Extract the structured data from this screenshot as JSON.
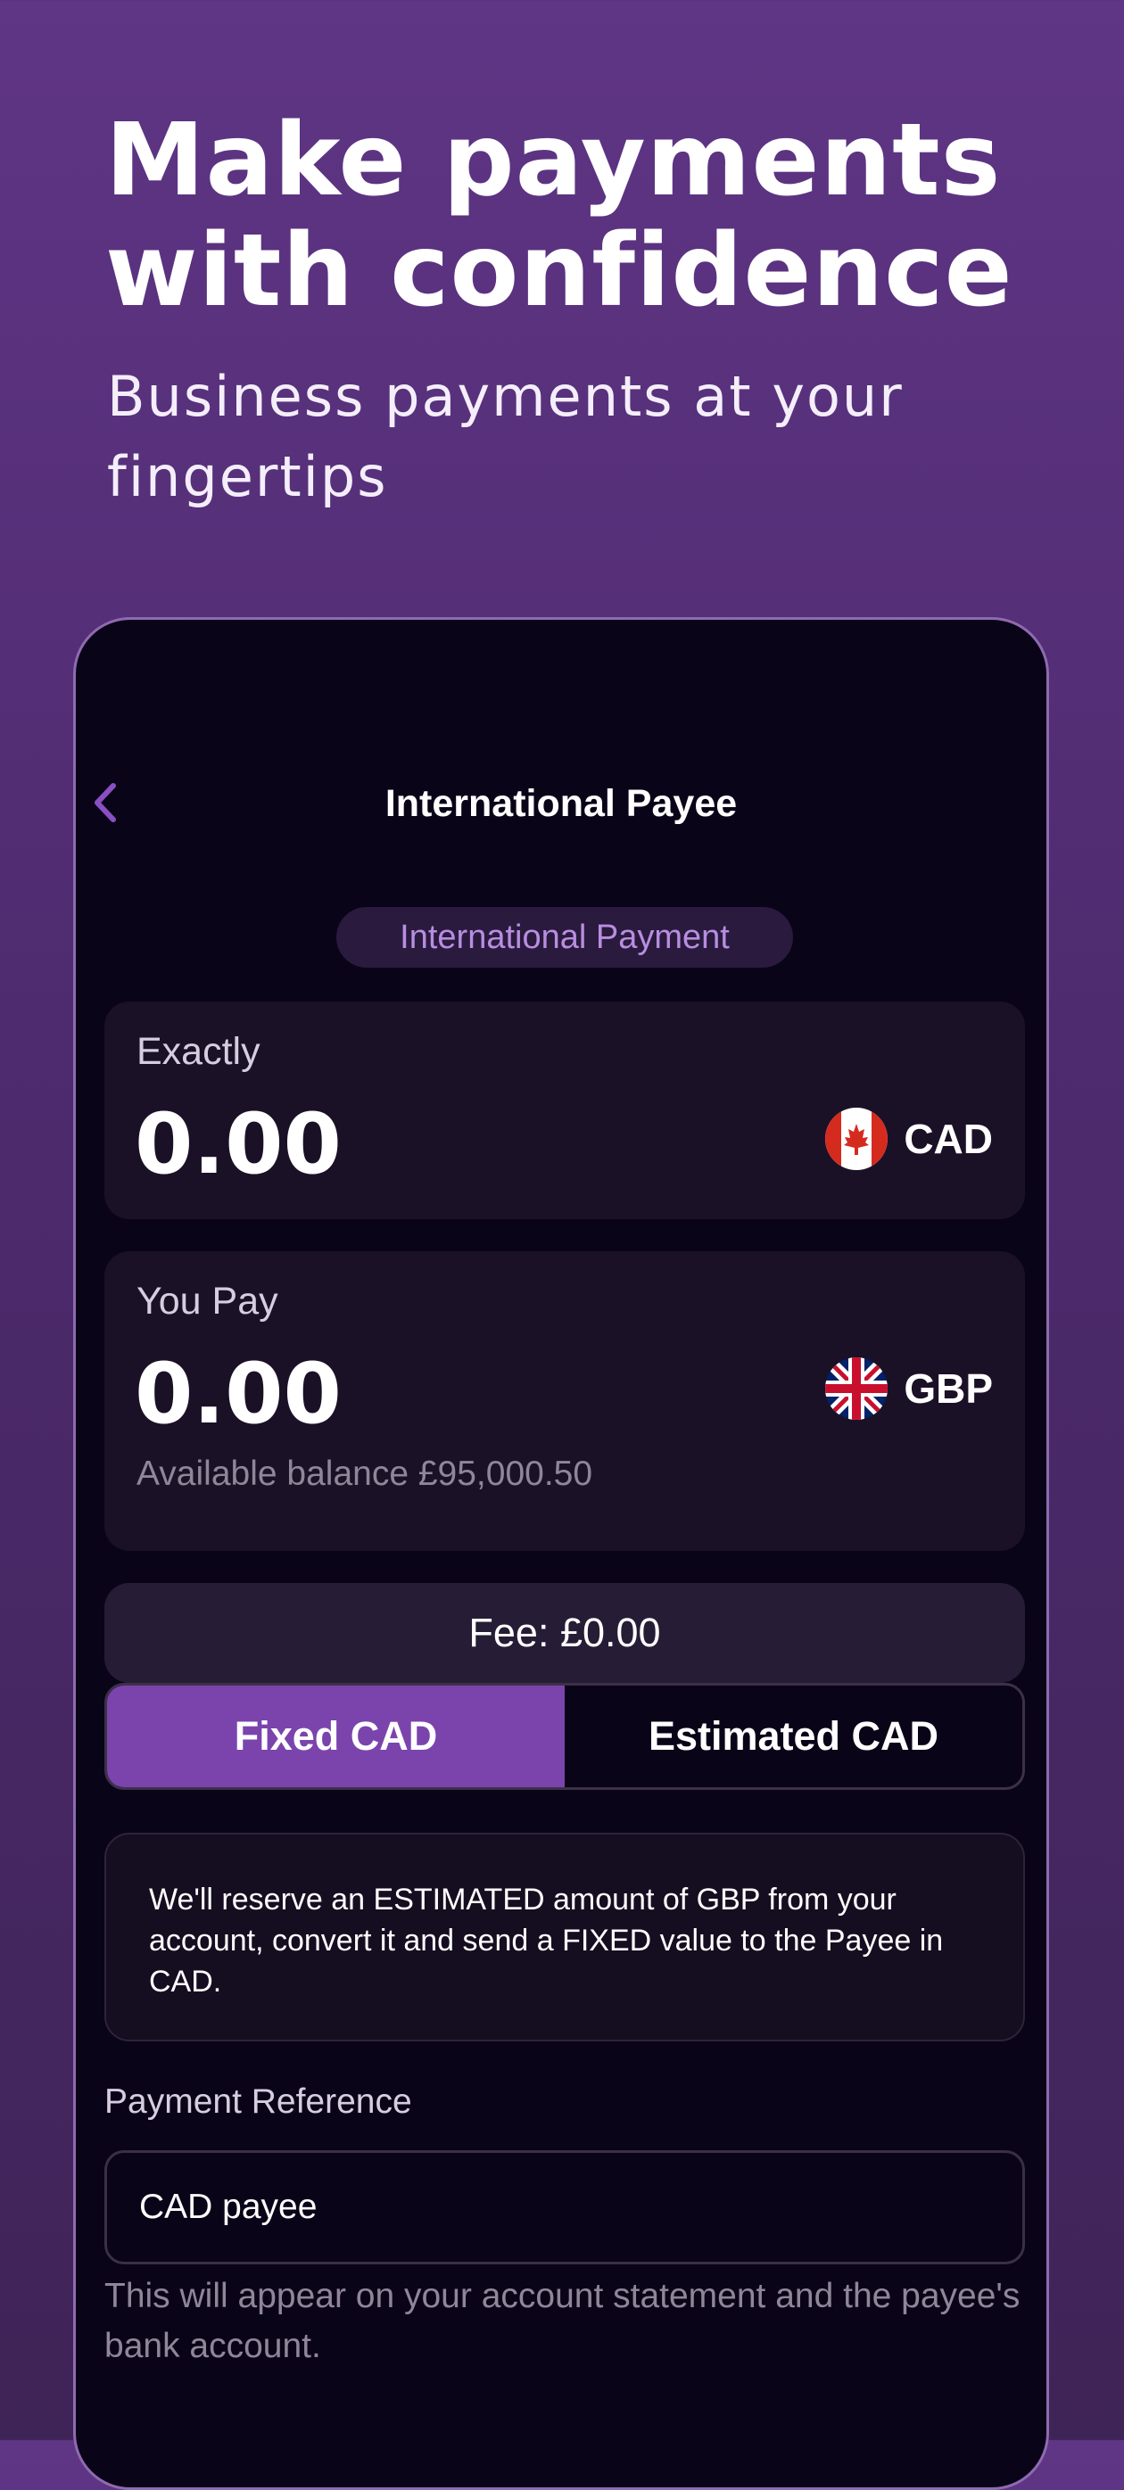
{
  "hero": {
    "title": "Make payments\nwith confidence",
    "subtitle": "Business payments at your fingertips"
  },
  "screen": {
    "title": "International Payee",
    "back_icon": "chevron-left-icon",
    "pill_label": "International Payment"
  },
  "exactly": {
    "label": "Exactly",
    "amount": "0.00",
    "currency": "CAD",
    "flag_icon": "canada-flag-icon"
  },
  "you_pay": {
    "label": "You Pay",
    "amount": "0.00",
    "currency": "GBP",
    "flag_icon": "uk-flag-icon",
    "balance": "Available balance £95,000.50"
  },
  "fee": {
    "text": "Fee: £0.00"
  },
  "toggle": {
    "options": [
      "Fixed CAD",
      "Estimated CAD"
    ],
    "selected": "Fixed CAD"
  },
  "info": {
    "text": "We'll reserve an ESTIMATED amount of GBP from your account, convert it and send a FIXED value to the Payee in CAD."
  },
  "payment_reference": {
    "label": "Payment Reference",
    "value": "CAD payee",
    "helper": "This will appear on your account statement and the payee's bank account."
  },
  "colors": {
    "background": "#5f3585",
    "accent": "#7b44ad",
    "pill_text": "#b88ee0",
    "phone_bg": "#0a0418"
  }
}
